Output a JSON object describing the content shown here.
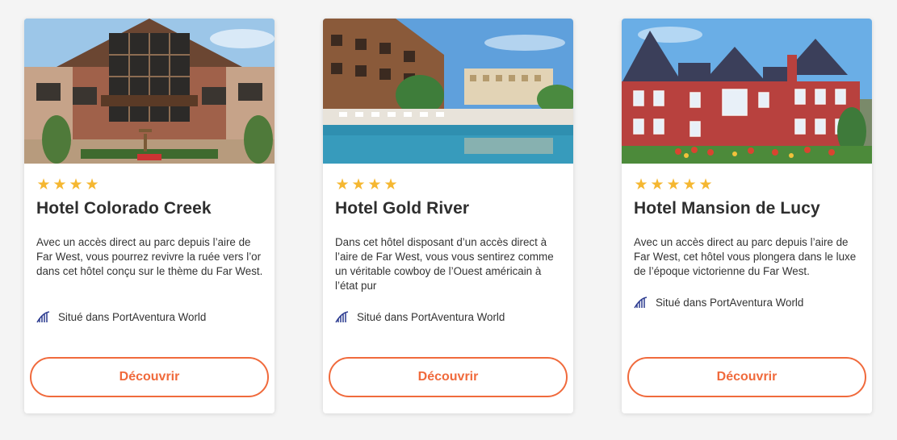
{
  "hotels": [
    {
      "stars": [
        "★",
        "★",
        "★",
        "★"
      ],
      "name": "Hotel Colorado Creek",
      "description": "Avec un accès direct au parc depuis l’aire de Far West, vous pourrez revivre la ruée vers l’or dans cet hôtel conçu sur le thème du Far West.",
      "location": "Situé dans PortAventura World",
      "button": "Découvrir"
    },
    {
      "stars": [
        "★",
        "★",
        "★",
        "★"
      ],
      "name": "Hotel Gold River",
      "description": "Dans cet hôtel disposant d’un accès direct à l’aire de Far West, vous vous sentirez comme un véritable cowboy de l’Ouest américain à l’état pur",
      "location": "Situé dans PortAventura World",
      "button": "Découvrir"
    },
    {
      "stars": [
        "★",
        "★",
        "★",
        "★",
        "★"
      ],
      "name": "Hotel Mansion de Lucy",
      "description": "Avec un accès direct au parc depuis l’aire de Far West, cet hôtel vous plongera dans le luxe de l’époque victorienne du Far West.",
      "location": "Situé dans PortAventura World",
      "button": "Découvrir"
    }
  ],
  "colors": {
    "accent": "#f06a3c",
    "star": "#f5b731",
    "icon": "#2b3a8f"
  },
  "icons": {
    "location": "park-ride-icon",
    "star": "star-icon"
  }
}
